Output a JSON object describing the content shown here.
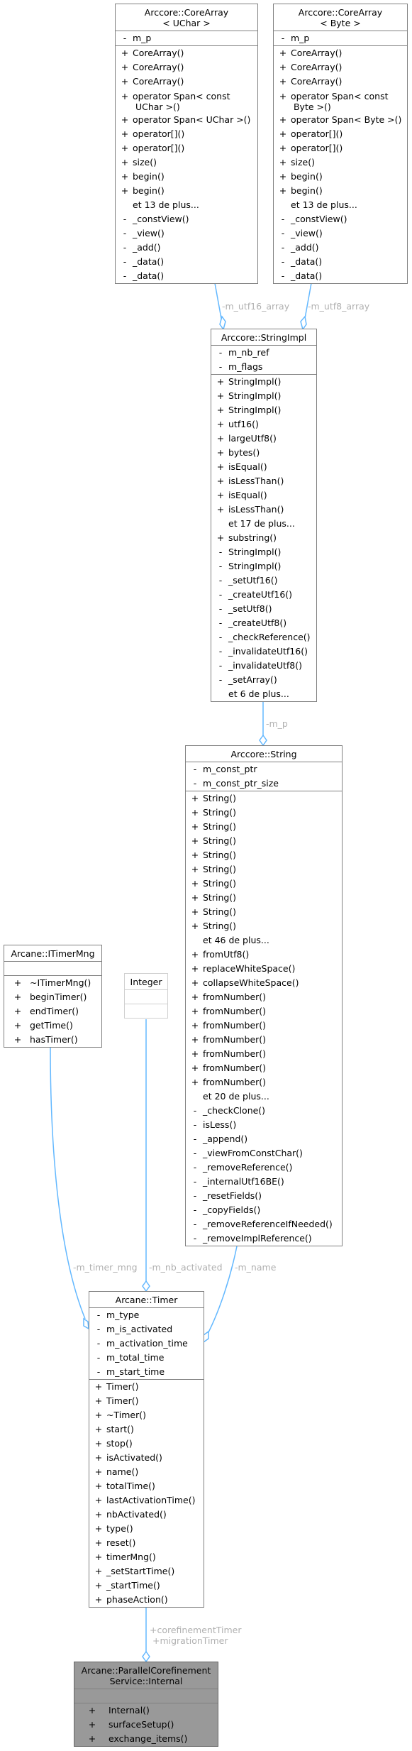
{
  "diagram": {
    "classes": {
      "corearray_uchar": {
        "title": "Arccore::CoreArray\n< UChar >",
        "attributes": [
          {
            "vis": "-",
            "name": "m_p"
          }
        ],
        "methods": [
          {
            "vis": "+",
            "name": "CoreArray()"
          },
          {
            "vis": "+",
            "name": "CoreArray()"
          },
          {
            "vis": "+",
            "name": "CoreArray()"
          },
          {
            "vis": "+",
            "name": "operator Span< const\n UChar >()"
          },
          {
            "vis": "+",
            "name": "operator Span< UChar >()"
          },
          {
            "vis": "+",
            "name": "operator[]()"
          },
          {
            "vis": "+",
            "name": "operator[]()"
          },
          {
            "vis": "+",
            "name": "size()"
          },
          {
            "vis": "+",
            "name": "begin()"
          },
          {
            "vis": "+",
            "name": "begin()"
          },
          {
            "vis": "",
            "name": "et 13 de plus..."
          },
          {
            "vis": "-",
            "name": "_constView()"
          },
          {
            "vis": "-",
            "name": "_view()"
          },
          {
            "vis": "-",
            "name": "_add()"
          },
          {
            "vis": "-",
            "name": "_data()"
          },
          {
            "vis": "-",
            "name": "_data()"
          }
        ]
      },
      "corearray_byte": {
        "title": "Arccore::CoreArray\n< Byte >",
        "attributes": [
          {
            "vis": "-",
            "name": "m_p"
          }
        ],
        "methods": [
          {
            "vis": "+",
            "name": "CoreArray()"
          },
          {
            "vis": "+",
            "name": "CoreArray()"
          },
          {
            "vis": "+",
            "name": "CoreArray()"
          },
          {
            "vis": "+",
            "name": "operator Span< const\n Byte >()"
          },
          {
            "vis": "+",
            "name": "operator Span< Byte >()"
          },
          {
            "vis": "+",
            "name": "operator[]()"
          },
          {
            "vis": "+",
            "name": "operator[]()"
          },
          {
            "vis": "+",
            "name": "size()"
          },
          {
            "vis": "+",
            "name": "begin()"
          },
          {
            "vis": "+",
            "name": "begin()"
          },
          {
            "vis": "",
            "name": "et 13 de plus..."
          },
          {
            "vis": "-",
            "name": "_constView()"
          },
          {
            "vis": "-",
            "name": "_view()"
          },
          {
            "vis": "-",
            "name": "_add()"
          },
          {
            "vis": "-",
            "name": "_data()"
          },
          {
            "vis": "-",
            "name": "_data()"
          }
        ]
      },
      "stringimpl": {
        "title": "Arccore::StringImpl",
        "attributes": [
          {
            "vis": "-",
            "name": "m_nb_ref"
          },
          {
            "vis": "-",
            "name": "m_flags"
          }
        ],
        "methods": [
          {
            "vis": "+",
            "name": "StringImpl()"
          },
          {
            "vis": "+",
            "name": "StringImpl()"
          },
          {
            "vis": "+",
            "name": "StringImpl()"
          },
          {
            "vis": "+",
            "name": "utf16()"
          },
          {
            "vis": "+",
            "name": "largeUtf8()"
          },
          {
            "vis": "+",
            "name": "bytes()"
          },
          {
            "vis": "+",
            "name": "isEqual()"
          },
          {
            "vis": "+",
            "name": "isLessThan()"
          },
          {
            "vis": "+",
            "name": "isEqual()"
          },
          {
            "vis": "+",
            "name": "isLessThan()"
          },
          {
            "vis": "",
            "name": "et 17 de plus..."
          },
          {
            "vis": "+",
            "name": "substring()"
          },
          {
            "vis": "-",
            "name": "StringImpl()"
          },
          {
            "vis": "-",
            "name": "StringImpl()"
          },
          {
            "vis": "-",
            "name": "_setUtf16()"
          },
          {
            "vis": "-",
            "name": "_createUtf16()"
          },
          {
            "vis": "-",
            "name": "_setUtf8()"
          },
          {
            "vis": "-",
            "name": "_createUtf8()"
          },
          {
            "vis": "-",
            "name": "_checkReference()"
          },
          {
            "vis": "-",
            "name": "_invalidateUtf16()"
          },
          {
            "vis": "-",
            "name": "_invalidateUtf8()"
          },
          {
            "vis": "-",
            "name": "_setArray()"
          },
          {
            "vis": "",
            "name": "et 6 de plus..."
          }
        ]
      },
      "string": {
        "title": "Arccore::String",
        "attributes": [
          {
            "vis": "-",
            "name": "m_const_ptr"
          },
          {
            "vis": "-",
            "name": "m_const_ptr_size"
          }
        ],
        "methods": [
          {
            "vis": "+",
            "name": "String()"
          },
          {
            "vis": "+",
            "name": "String()"
          },
          {
            "vis": "+",
            "name": "String()"
          },
          {
            "vis": "+",
            "name": "String()"
          },
          {
            "vis": "+",
            "name": "String()"
          },
          {
            "vis": "+",
            "name": "String()"
          },
          {
            "vis": "+",
            "name": "String()"
          },
          {
            "vis": "+",
            "name": "String()"
          },
          {
            "vis": "+",
            "name": "String()"
          },
          {
            "vis": "+",
            "name": "String()"
          },
          {
            "vis": "",
            "name": "et 46 de plus..."
          },
          {
            "vis": "+",
            "name": "fromUtf8()"
          },
          {
            "vis": "+",
            "name": "replaceWhiteSpace()"
          },
          {
            "vis": "+",
            "name": "collapseWhiteSpace()"
          },
          {
            "vis": "+",
            "name": "fromNumber()"
          },
          {
            "vis": "+",
            "name": "fromNumber()"
          },
          {
            "vis": "+",
            "name": "fromNumber()"
          },
          {
            "vis": "+",
            "name": "fromNumber()"
          },
          {
            "vis": "+",
            "name": "fromNumber()"
          },
          {
            "vis": "+",
            "name": "fromNumber()"
          },
          {
            "vis": "+",
            "name": "fromNumber()"
          },
          {
            "vis": "",
            "name": "et 20 de plus..."
          },
          {
            "vis": "-",
            "name": "_checkClone()"
          },
          {
            "vis": "-",
            "name": "isLess()"
          },
          {
            "vis": "-",
            "name": "_append()"
          },
          {
            "vis": "-",
            "name": "_viewFromConstChar()"
          },
          {
            "vis": "-",
            "name": "_removeReference()"
          },
          {
            "vis": "-",
            "name": "_internalUtf16BE()"
          },
          {
            "vis": "-",
            "name": "_resetFields()"
          },
          {
            "vis": "-",
            "name": "_copyFields()"
          },
          {
            "vis": "-",
            "name": "_removeReferenceIfNeeded()"
          },
          {
            "vis": "-",
            "name": "_removeImplReference()"
          }
        ]
      },
      "itimermng": {
        "title": "Arcane::ITimerMng",
        "attributes": [],
        "methods": [
          {
            "vis": "+",
            "name": "~ITimerMng()"
          },
          {
            "vis": "+",
            "name": "beginTimer()"
          },
          {
            "vis": "+",
            "name": "endTimer()"
          },
          {
            "vis": "+",
            "name": "getTime()"
          },
          {
            "vis": "+",
            "name": "hasTimer()"
          }
        ]
      },
      "integer": {
        "title": "Integer",
        "attributes": [],
        "methods": []
      },
      "timer": {
        "title": "Arcane::Timer",
        "attributes": [
          {
            "vis": "-",
            "name": "m_type"
          },
          {
            "vis": "-",
            "name": "m_is_activated"
          },
          {
            "vis": "-",
            "name": "m_activation_time"
          },
          {
            "vis": "-",
            "name": "m_total_time"
          },
          {
            "vis": "-",
            "name": "m_start_time"
          }
        ],
        "methods": [
          {
            "vis": "+",
            "name": "Timer()"
          },
          {
            "vis": "+",
            "name": "Timer()"
          },
          {
            "vis": "+",
            "name": "~Timer()"
          },
          {
            "vis": "+",
            "name": "start()"
          },
          {
            "vis": "+",
            "name": "stop()"
          },
          {
            "vis": "+",
            "name": "isActivated()"
          },
          {
            "vis": "+",
            "name": "name()"
          },
          {
            "vis": "+",
            "name": "totalTime()"
          },
          {
            "vis": "+",
            "name": "lastActivationTime()"
          },
          {
            "vis": "+",
            "name": "nbActivated()"
          },
          {
            "vis": "+",
            "name": "type()"
          },
          {
            "vis": "+",
            "name": "reset()"
          },
          {
            "vis": "+",
            "name": "timerMng()"
          },
          {
            "vis": "+",
            "name": "_setStartTime()"
          },
          {
            "vis": "+",
            "name": "_startTime()"
          },
          {
            "vis": "+",
            "name": "phaseAction()"
          }
        ]
      },
      "internal": {
        "title": "Arcane::ParallelCorefinement\nService::Internal",
        "attributes": [],
        "methods": [
          {
            "vis": "+",
            "name": "Internal()"
          },
          {
            "vis": "+",
            "name": "surfaceSetup()"
          },
          {
            "vis": "+",
            "name": "exchange_items()"
          }
        ]
      }
    },
    "edges": {
      "utf16": {
        "label": "-m_utf16_array",
        "from": "Arccore::CoreArray< UChar >",
        "to": "Arccore::StringImpl"
      },
      "utf8": {
        "label": "-m_utf8_array",
        "from": "Arccore::CoreArray< Byte >",
        "to": "Arccore::StringImpl"
      },
      "m_p": {
        "label": "-m_p",
        "from": "Arccore::StringImpl",
        "to": "Arccore::String"
      },
      "timer_mng": {
        "label": "-m_timer_mng",
        "from": "Arcane::ITimerMng",
        "to": "Arcane::Timer"
      },
      "nb_activated": {
        "label": "-m_nb_activated",
        "from": "Integer",
        "to": "Arcane::Timer"
      },
      "name": {
        "label": "-m_name",
        "from": "Arccore::String",
        "to": "Arcane::Timer"
      },
      "timers": {
        "label": "+corefinementTimer\n +migrationTimer",
        "from": "Arcane::Timer",
        "to": "Arcane::ParallelCorefinementService::Internal"
      }
    },
    "colors": {
      "edge": "#63b8ff",
      "edge_label": "#b0b0b0",
      "border": "#808080",
      "focus_fill": "#999999"
    }
  }
}
